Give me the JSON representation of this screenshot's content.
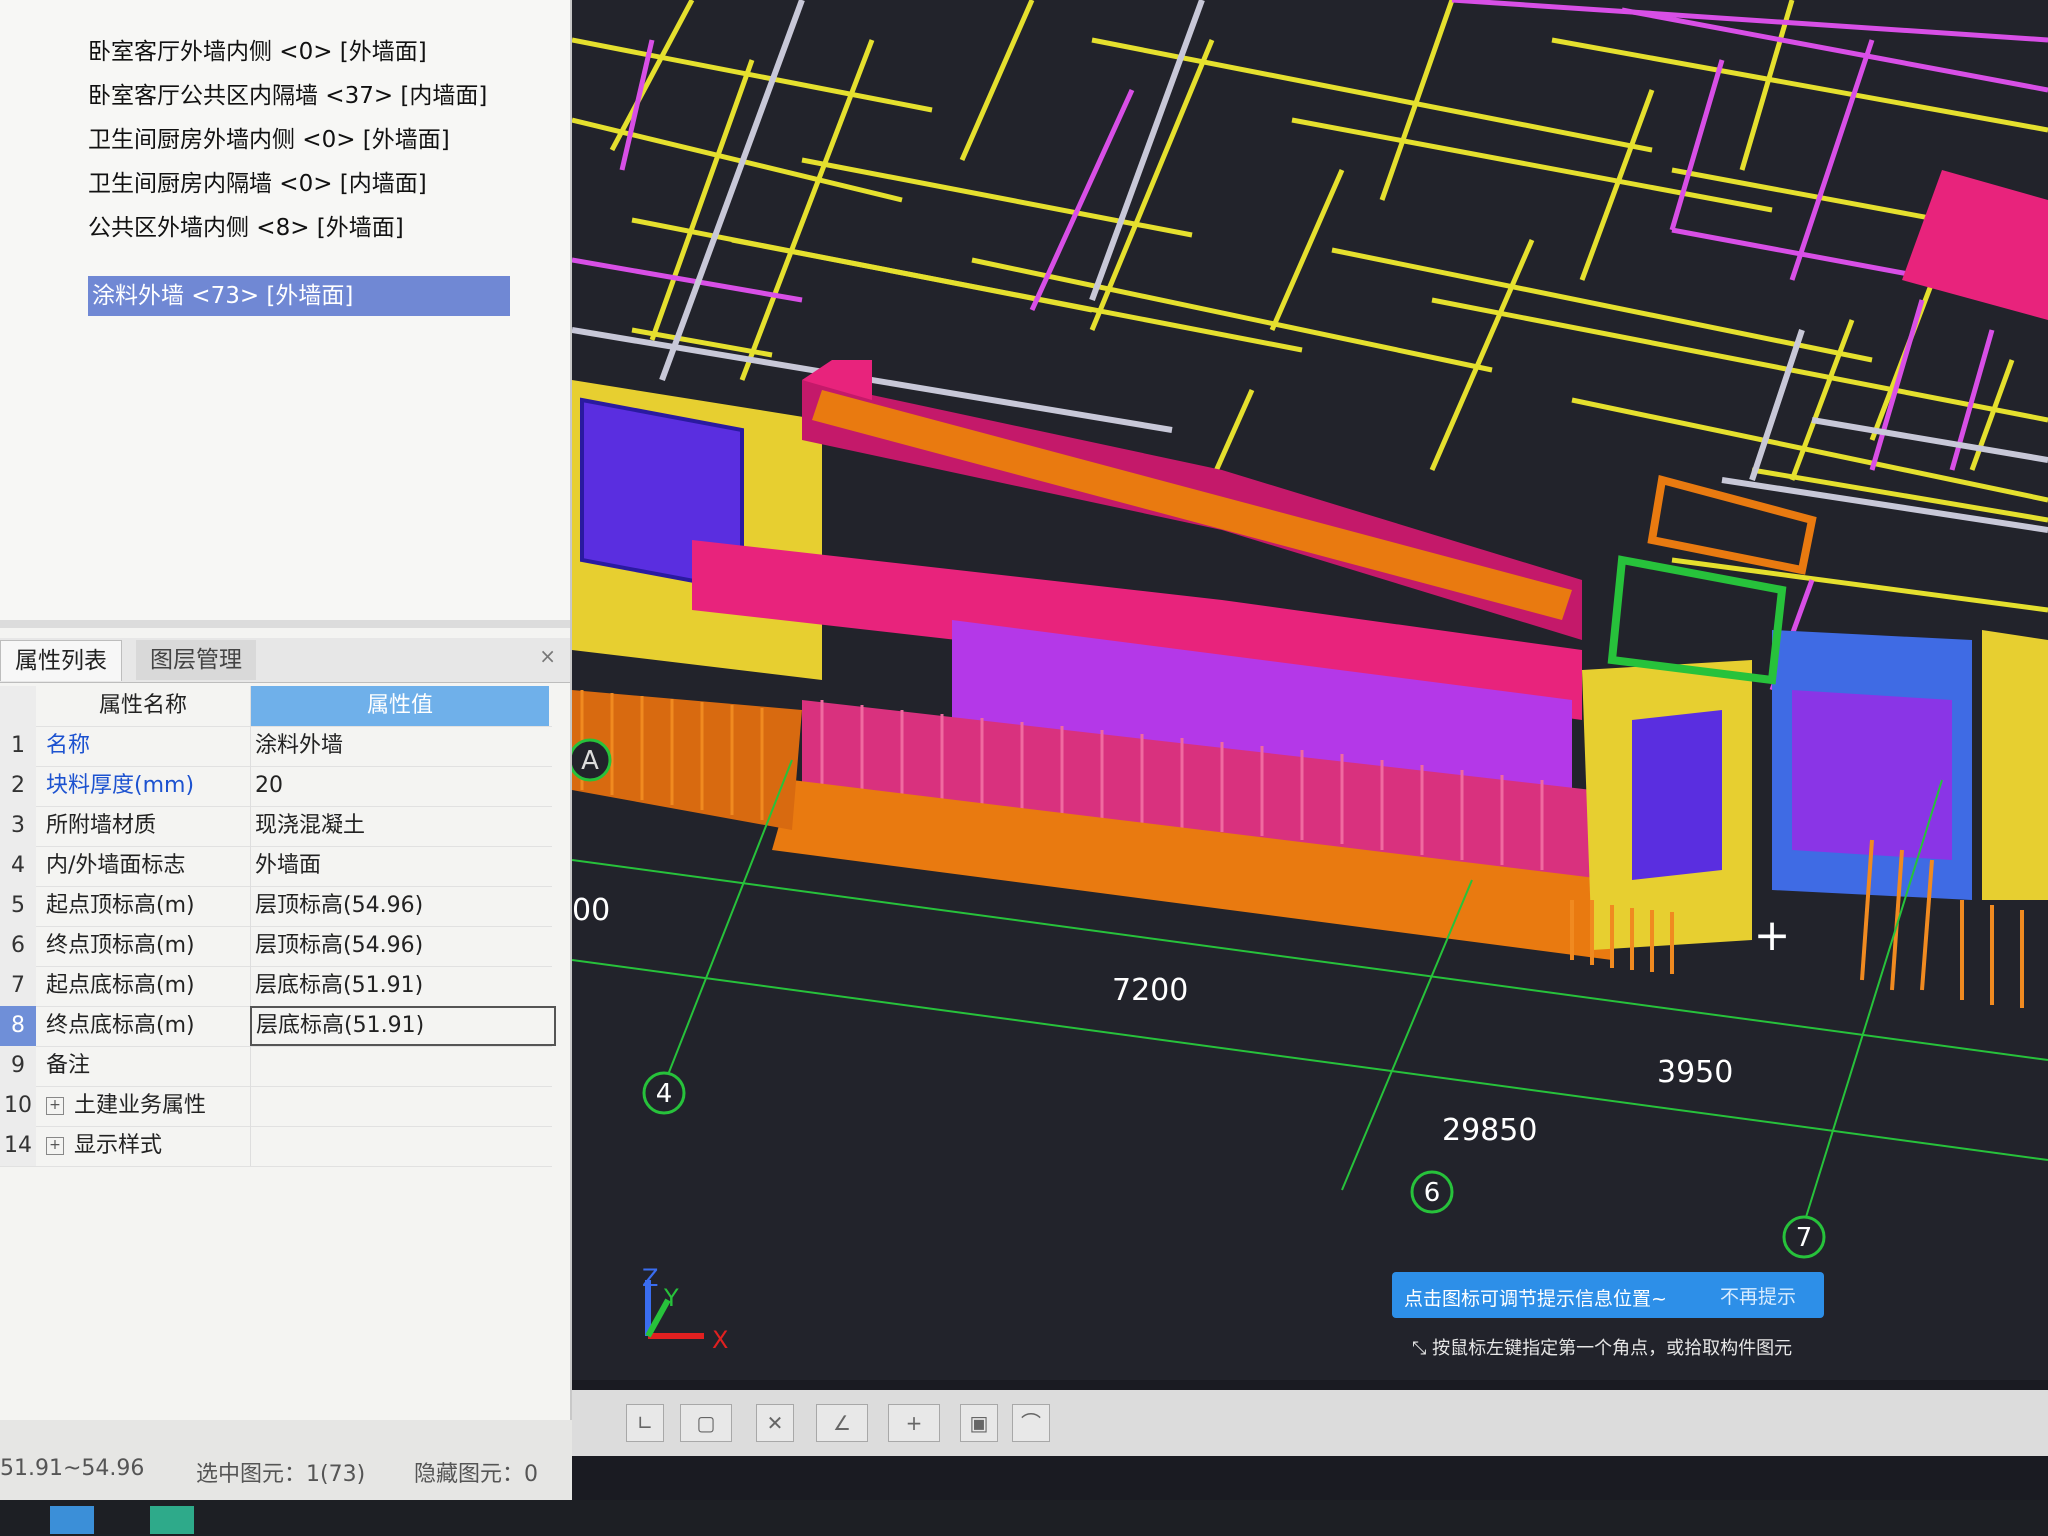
{
  "tree": {
    "items": [
      {
        "label": "卧室客厅外墙内侧 <0> [外墙面]"
      },
      {
        "label": "卧室客厅公共区内隔墙 <37> [内墙面]"
      },
      {
        "label": "卫生间厨房外墙内侧 <0> [外墙面]"
      },
      {
        "label": "卫生间厨房内隔墙 <0> [内墙面]"
      },
      {
        "label": "公共区外墙内侧 <8> [外墙面]"
      },
      {
        "label": "涂料外墙 <73> [外墙面]"
      }
    ]
  },
  "panel": {
    "tabs": [
      {
        "label": "属性列表"
      },
      {
        "label": "图层管理"
      }
    ],
    "close": "×"
  },
  "properties": {
    "header": {
      "name": "属性名称",
      "value": "属性值"
    },
    "rows": [
      {
        "num": "1",
        "name": "名称",
        "value": "涂料外墙"
      },
      {
        "num": "2",
        "name": "块料厚度(mm)",
        "value": "20"
      },
      {
        "num": "3",
        "name": "所附墙材质",
        "value": "现浇混凝土"
      },
      {
        "num": "4",
        "name": "内/外墙面标志",
        "value": "外墙面"
      },
      {
        "num": "5",
        "name": "起点顶标高(m)",
        "value": "层顶标高(54.96)"
      },
      {
        "num": "6",
        "name": "终点顶标高(m)",
        "value": "层顶标高(54.96)"
      },
      {
        "num": "7",
        "name": "起点底标高(m)",
        "value": "层底标高(51.91)"
      },
      {
        "num": "8",
        "name": "终点底标高(m)",
        "value": "层底标高(51.91)"
      },
      {
        "num": "9",
        "name": "备注",
        "value": ""
      },
      {
        "num": "10",
        "name": "土建业务属性",
        "value": ""
      },
      {
        "num": "14",
        "name": "显示样式",
        "value": ""
      }
    ],
    "expander": "+"
  },
  "viewport": {
    "dimensions": [
      "7200",
      "3950",
      "29850"
    ],
    "axes": [
      "4",
      "6",
      "7"
    ],
    "row_label": "A",
    "partial_dim": "00",
    "triad": {
      "z": "Z",
      "y": "Y",
      "x": "X"
    },
    "cursor": "+"
  },
  "hint": {
    "message": "点击图标可调节提示信息位置~",
    "dismiss": "不再提示"
  },
  "prompt": "按鼠标左键指定第一个角点，或拾取构件图元",
  "status": {
    "elevation": "51.91~54.96",
    "selected": "选中图元：1(73)",
    "hidden": "隐藏图元：0"
  },
  "toolbar": {
    "icons": [
      "ortho-icon",
      "select-box-icon",
      "delete-icon",
      "angle-icon",
      "add-point-icon",
      "layer-icon",
      "arc-icon"
    ]
  },
  "colors": {
    "grid_yellow": "#e5e02e",
    "grid_magenta": "#d84fe6",
    "axis_green": "#27c23b",
    "wall_pink": "#e8237c",
    "wall_orange": "#e97a10",
    "window_purple": "#5a2ee0",
    "highlight": "#7088d4",
    "hint_blue": "#2d8fe8"
  }
}
